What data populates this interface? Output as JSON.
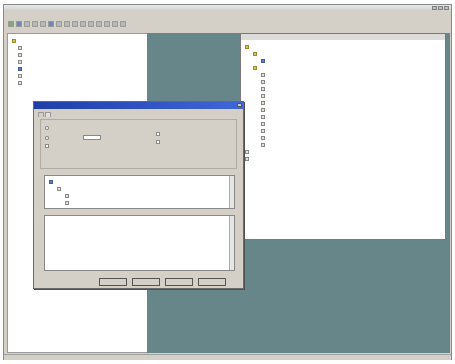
{
  "menus": [],
  "toolbar_icons": [
    "green",
    "blue",
    "gray",
    "gray",
    "gray",
    "blue",
    "gray",
    "gray",
    "gray",
    "gray",
    "gray",
    "gray",
    "gray",
    "gray",
    "gray"
  ],
  "left_tree": [
    {
      "level": 0,
      "icon": "folder-icon",
      "label": ""
    },
    {
      "level": 1,
      "icon": "doc-icon",
      "label": ""
    },
    {
      "level": 1,
      "icon": "doc-icon",
      "label": ""
    },
    {
      "level": 1,
      "icon": "doc-icon",
      "label": ""
    },
    {
      "level": 1,
      "icon": "doc-icon",
      "label": "",
      "selected": true
    },
    {
      "level": 1,
      "icon": "doc-icon",
      "label": ""
    },
    {
      "level": 1,
      "icon": "doc-icon",
      "label": ""
    }
  ],
  "right_tree": [
    {
      "level": 0,
      "icon": "folder-icon",
      "label": ""
    },
    {
      "level": 1,
      "icon": "folder-icon",
      "label": ""
    },
    {
      "level": 2,
      "icon": "doc-icon",
      "label": "",
      "selected": true
    },
    {
      "level": 1,
      "icon": "folder-icon",
      "label": ""
    },
    {
      "level": 2,
      "icon": "doc-icon",
      "label": ""
    },
    {
      "level": 2,
      "icon": "doc-icon",
      "label": ""
    },
    {
      "level": 2,
      "icon": "doc-icon",
      "label": ""
    },
    {
      "level": 2,
      "icon": "doc-icon",
      "label": ""
    },
    {
      "level": 2,
      "icon": "doc-icon",
      "label": ""
    },
    {
      "level": 2,
      "icon": "doc-icon",
      "label": ""
    },
    {
      "level": 2,
      "icon": "doc-icon",
      "label": ""
    },
    {
      "level": 2,
      "icon": "doc-icon",
      "label": ""
    },
    {
      "level": 2,
      "icon": "doc-icon",
      "label": ""
    },
    {
      "level": 2,
      "icon": "doc-icon",
      "label": ""
    },
    {
      "level": 2,
      "icon": "doc-icon",
      "label": ""
    },
    {
      "level": 0,
      "icon": "doc-icon",
      "label": ""
    },
    {
      "level": 0,
      "icon": "doc-icon",
      "label": ""
    }
  ],
  "dialog": {
    "title": "",
    "tabs": [
      "",
      ""
    ],
    "options_left": [
      "",
      "",
      ""
    ],
    "options_right": [
      "",
      ""
    ],
    "spin_value": "",
    "tree_label": "",
    "tree": [
      {
        "level": 0,
        "label": "",
        "selected": true
      },
      {
        "level": 1,
        "label": ""
      },
      {
        "level": 2,
        "label": ""
      },
      {
        "level": 2,
        "label": ""
      }
    ],
    "list_lines": [
      "",
      "",
      "",
      "",
      "",
      "",
      "",
      ""
    ],
    "buttons": [
      "",
      "",
      "",
      ""
    ]
  },
  "status": {
    "left": "",
    "right": ""
  },
  "colors": {
    "teal_background": "#66868a",
    "dialog_title": "#1f3ea8",
    "selection": "#3a5aa8"
  }
}
